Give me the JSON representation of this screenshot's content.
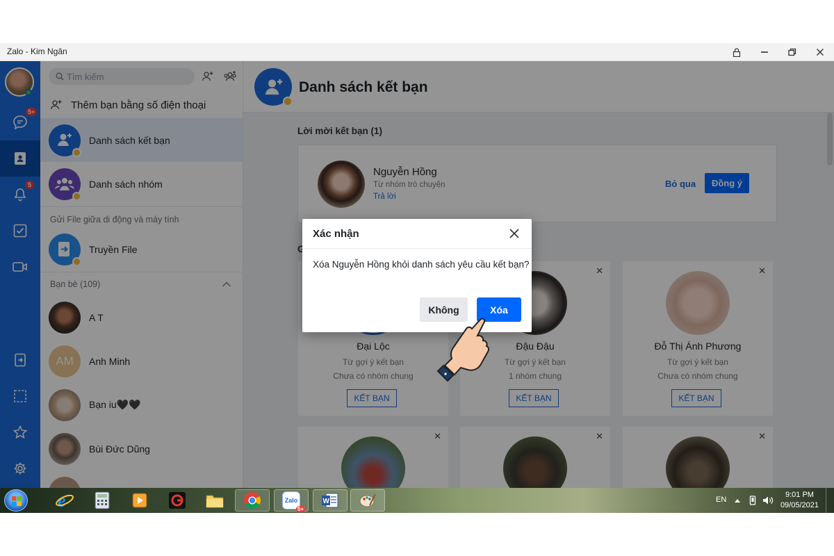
{
  "window": {
    "title": "Zalo - Kim Ngân"
  },
  "nav": {
    "badges": {
      "messages": "5+",
      "notifications": "5"
    }
  },
  "sidebar": {
    "search_placeholder": "Tìm kiếm",
    "add_by_phone": "Thêm bạn bằng số điện thoại",
    "friend_list": "Danh sách kết bạn",
    "group_list": "Danh sách nhóm",
    "file_section": "Gửi File giữa di động và máy tính",
    "transfer_file": "Truyền File",
    "friends_header": "Bạn bè (109)",
    "friends": [
      {
        "name": "A T",
        "initials": ""
      },
      {
        "name": "Anh Minh",
        "initials": "AM"
      },
      {
        "name": "Bạn iu🖤🖤",
        "initials": ""
      },
      {
        "name": "Bùi Đức Dũng",
        "initials": ""
      }
    ]
  },
  "main": {
    "title": "Danh sách kết bạn",
    "requests_title": "Lời mời kết bạn (1)",
    "request": {
      "name": "Nguyễn Hồng",
      "source": "Từ nhóm trò chuyện",
      "reply": "Trả lời",
      "skip": "Bỏ qua",
      "accept": "Đồng ý"
    },
    "suggest_title_initial": "G",
    "suggestions": [
      {
        "name": "Đại Lộc",
        "reason": "Từ gợi ý kết bạn",
        "groups": "Chưa có nhóm chung",
        "action": "KẾT BẠN"
      },
      {
        "name": "Đậu Đậu",
        "reason": "Từ gợi ý kết bạn",
        "groups": "1 nhóm chung",
        "action": "KẾT BẠN"
      },
      {
        "name": "Đỗ Thị Ánh Phương",
        "reason": "Từ gợi ý kết bạn",
        "groups": "Chưa có nhóm chung",
        "action": "KẾT BẠN"
      }
    ]
  },
  "dialog": {
    "title": "Xác nhận",
    "message": "Xóa Nguyễn Hồng khỏi danh sách yêu cầu kết bạn?",
    "cancel": "Không",
    "confirm": "Xóa"
  },
  "taskbar": {
    "zalo_badge": "5+",
    "lang": "EN",
    "time": "9:01 PM",
    "date": "09/05/2021"
  },
  "colors": {
    "brand": "#1d6ad8",
    "confirm_button": "#0068ff",
    "badge": "#f03c3c"
  }
}
